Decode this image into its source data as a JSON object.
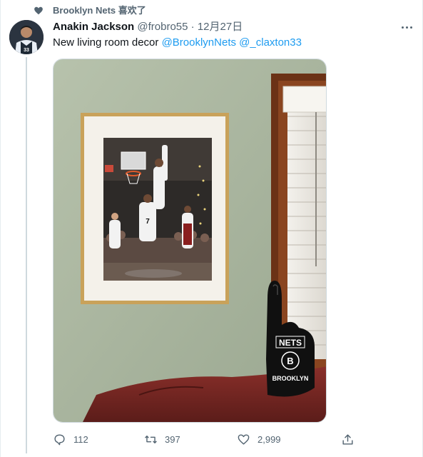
{
  "social_context": {
    "text": "Brooklyn Nets 喜欢了"
  },
  "tweet": {
    "display_name": "Anakin Jackson",
    "handle": "@frobro55",
    "separator": " · ",
    "date": "12月27日",
    "text_plain": "New living room decor ",
    "mention_1": "@BrooklynNets",
    "mention_2": "@_claxton33"
  },
  "photo": {
    "foam_finger_top": "NETS",
    "foam_finger_logo": "B",
    "foam_finger_bottom": "BROOKLYN",
    "jersey_number": "7"
  },
  "actions": {
    "reply_count": "112",
    "retweet_count": "397",
    "like_count": "2,999"
  },
  "colors": {
    "accent": "#1d9bf0",
    "secondary_text": "#536471"
  }
}
